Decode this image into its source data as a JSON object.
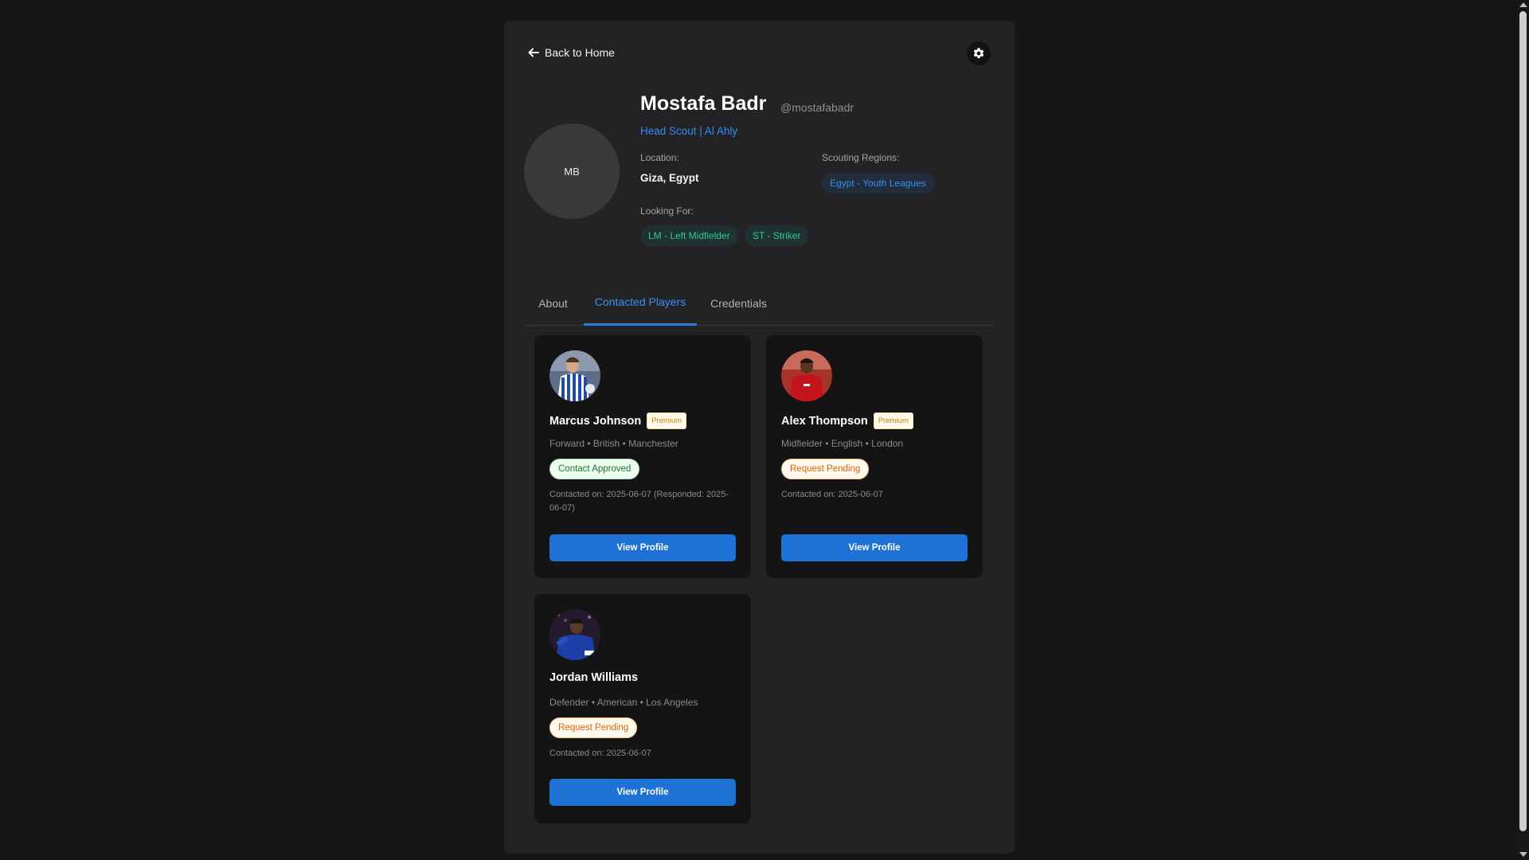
{
  "header": {
    "back_label": "Back to Home"
  },
  "profile": {
    "initials": "MB",
    "name": "Mostafa Badr",
    "handle": "@mostafabadr",
    "role": "Head Scout | Al Ahly",
    "location_label": "Location:",
    "location": "Giza, Egypt",
    "regions_label": "Scouting Regions:",
    "regions": [
      "Egypt - Youth Leagues"
    ],
    "looking_label": "Looking For:",
    "looking_for": [
      "LM - Left Midfielder",
      "ST - Striker"
    ]
  },
  "tabs": [
    {
      "label": "About",
      "active": false
    },
    {
      "label": "Contacted Players",
      "active": true
    },
    {
      "label": "Credentials",
      "active": false
    }
  ],
  "players": [
    {
      "name": "Marcus Johnson",
      "badge": "Premium",
      "meta": "Forward • British • Manchester",
      "status": "Contact Approved",
      "contacted": "Contacted on: 2025-06-07 (Responded: 2025-06-07)",
      "button": "View Profile"
    },
    {
      "name": "Alex Thompson",
      "badge": "Premium",
      "meta": "Midfielder • English • London",
      "status": "Request Pending",
      "contacted": "Contacted on: 2025-06-07",
      "button": "View Profile"
    },
    {
      "name": "Jordan Williams",
      "badge": "",
      "meta": "Defender • American • Los Angeles",
      "status": "Request Pending",
      "contacted": "Contacted on: 2025-06-07",
      "button": "View Profile"
    }
  ],
  "colors": {
    "accent": "#1f72d5",
    "link": "#2f8ff5",
    "approved": "#1b7a35",
    "pending": "#d6680e",
    "premium": "#c47d08"
  }
}
